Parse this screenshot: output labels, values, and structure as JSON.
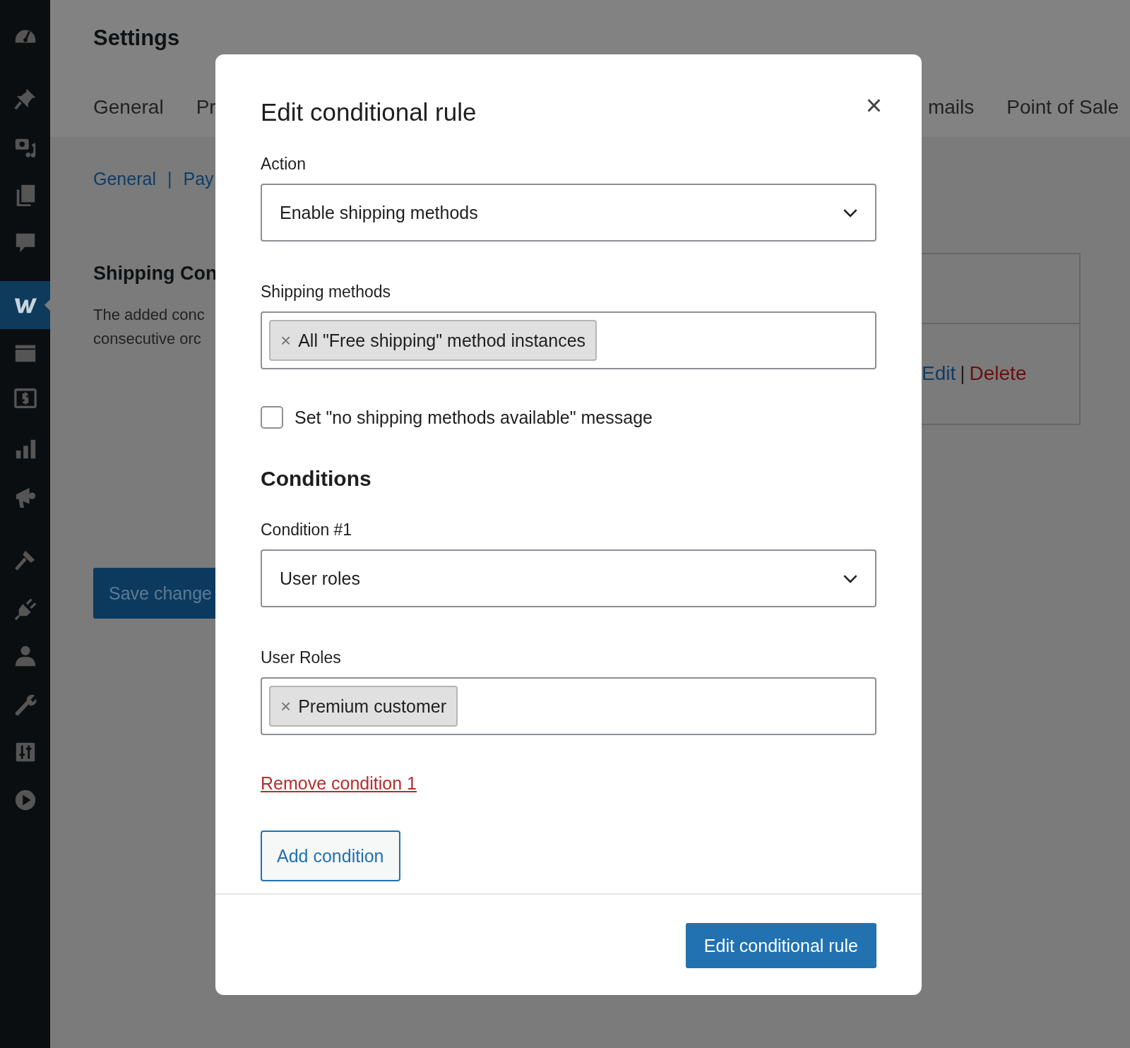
{
  "sidebar": {
    "items": [
      {
        "selected": false
      },
      {
        "selected": false
      },
      {
        "selected": false
      },
      {
        "selected": false
      },
      {
        "selected": false
      },
      {
        "selected": true
      },
      {
        "selected": false
      },
      {
        "selected": false
      },
      {
        "selected": false
      },
      {
        "selected": false
      },
      {
        "selected": false
      },
      {
        "selected": false
      },
      {
        "selected": false
      },
      {
        "selected": false
      },
      {
        "selected": false
      },
      {
        "selected": false
      }
    ]
  },
  "page": {
    "title": "Settings",
    "tabs_left": [
      {
        "label": "General"
      },
      {
        "label": "Pr"
      }
    ],
    "tabs_right": [
      {
        "label": "mails"
      },
      {
        "label": "Point of Sale"
      }
    ],
    "sublinks": [
      {
        "label": "General"
      },
      {
        "label": "Pay"
      }
    ],
    "sublink_separator": "|",
    "heading": "Shipping Con",
    "description": [
      "The added conc",
      "consecutive orc"
    ],
    "save_button": "Save change",
    "rule_actions": {
      "edit": "Edit",
      "separator": "|",
      "delete": "Delete"
    }
  },
  "modal": {
    "title": "Edit conditional rule",
    "close": "×",
    "action": {
      "label": "Action",
      "value": "Enable shipping methods"
    },
    "shipping_methods": {
      "label": "Shipping methods",
      "tags": [
        {
          "remove": "×",
          "label": "All \"Free shipping\" method instances"
        }
      ]
    },
    "message_checkbox": {
      "label": "Set \"no shipping methods available\" message",
      "checked": false
    },
    "conditions_heading": "Conditions",
    "conditions": [
      {
        "label": "Condition #1",
        "value": "User roles",
        "values_label": "User Roles",
        "tags": [
          {
            "remove": "×",
            "label": "Premium customer"
          }
        ],
        "remove_link": "Remove condition 1"
      }
    ],
    "add_condition": "Add condition",
    "submit": "Edit conditional rule"
  }
}
